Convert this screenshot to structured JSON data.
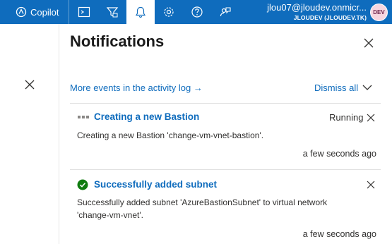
{
  "topbar": {
    "copilot_label": "Copilot",
    "icons": [
      "copilot-icon",
      "cloud-shell-icon",
      "directory-filter-icon",
      "bell-icon",
      "gear-icon",
      "help-icon",
      "feedback-icon"
    ],
    "account_email": "jlou07@jloudev.onmicr...",
    "account_directory": "JLOUDEV (JLOUDEV.TK)",
    "avatar_text": "DEV",
    "accent_color": "#0f6cbd"
  },
  "panel": {
    "title": "Notifications",
    "activity_link": "More events in the activity log →",
    "dismiss_label": "Dismiss all"
  },
  "notifications": [
    {
      "title": "Creating a new Bastion",
      "status": "Running",
      "body": "Creating a new Bastion 'change-vm-vnet-bastion'.",
      "time": "a few seconds ago",
      "icon": "in-progress-dots-icon"
    },
    {
      "title": "Successfully added subnet",
      "body": "Successfully added subnet 'AzureBastionSubnet' to virtual network 'change-vm-vnet'.",
      "time": "a few seconds ago",
      "icon": "success-check-icon",
      "icon_color": "#107c10"
    }
  ]
}
